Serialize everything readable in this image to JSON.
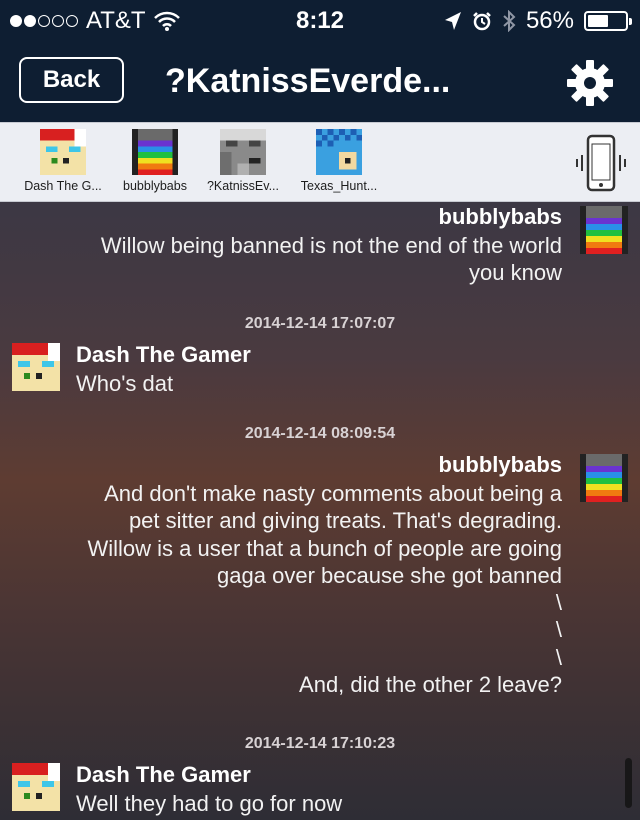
{
  "status_bar": {
    "carrier": "AT&T",
    "time": "8:12",
    "battery": "56%",
    "battery_level": 0.56,
    "signal_bars_filled": 2,
    "signal_bars_total": 5,
    "icons": [
      "wifi-icon",
      "location-arrow-icon",
      "alarm-icon",
      "bluetooth-icon",
      "battery-icon"
    ]
  },
  "nav": {
    "back_label": "Back",
    "title": "?KatnissEverde...",
    "settings_icon": "gear-icon"
  },
  "participants": [
    {
      "name": "Dash The G...",
      "avatar": "red-santa-hat-skin"
    },
    {
      "name": "bubblybabs",
      "avatar": "rainbow-visor-skin"
    },
    {
      "name": "?KatnissEv...",
      "avatar": "gray-skin"
    },
    {
      "name": "Texas_Hunt...",
      "avatar": "blue-checker-skin"
    }
  ],
  "vibrate_icon": "phone-vibrate-icon",
  "messages": [
    {
      "sender": "bubblybabs",
      "side": "right",
      "lines": [
        "Willow being banned is not the end of the world",
        "you know"
      ]
    },
    {
      "timestamp": "2014-12-14 17:07:07",
      "sender": "Dash The Gamer",
      "side": "left",
      "lines": [
        "Who's dat"
      ]
    },
    {
      "timestamp": "2014-12-14 08:09:54",
      "sender": "bubblybabs",
      "side": "right",
      "lines": [
        "And don't make nasty comments about being a",
        "pet sitter and giving treats.  That's degrading.",
        "Willow is a user that a bunch of people are going",
        "gaga over because she got banned",
        "\\",
        "\\",
        "\\",
        "And, did the other 2 leave?"
      ]
    },
    {
      "timestamp": "2014-12-14 17:10:23",
      "sender": "Dash The Gamer",
      "side": "left",
      "lines": [
        "Well they had to go for now"
      ]
    }
  ]
}
